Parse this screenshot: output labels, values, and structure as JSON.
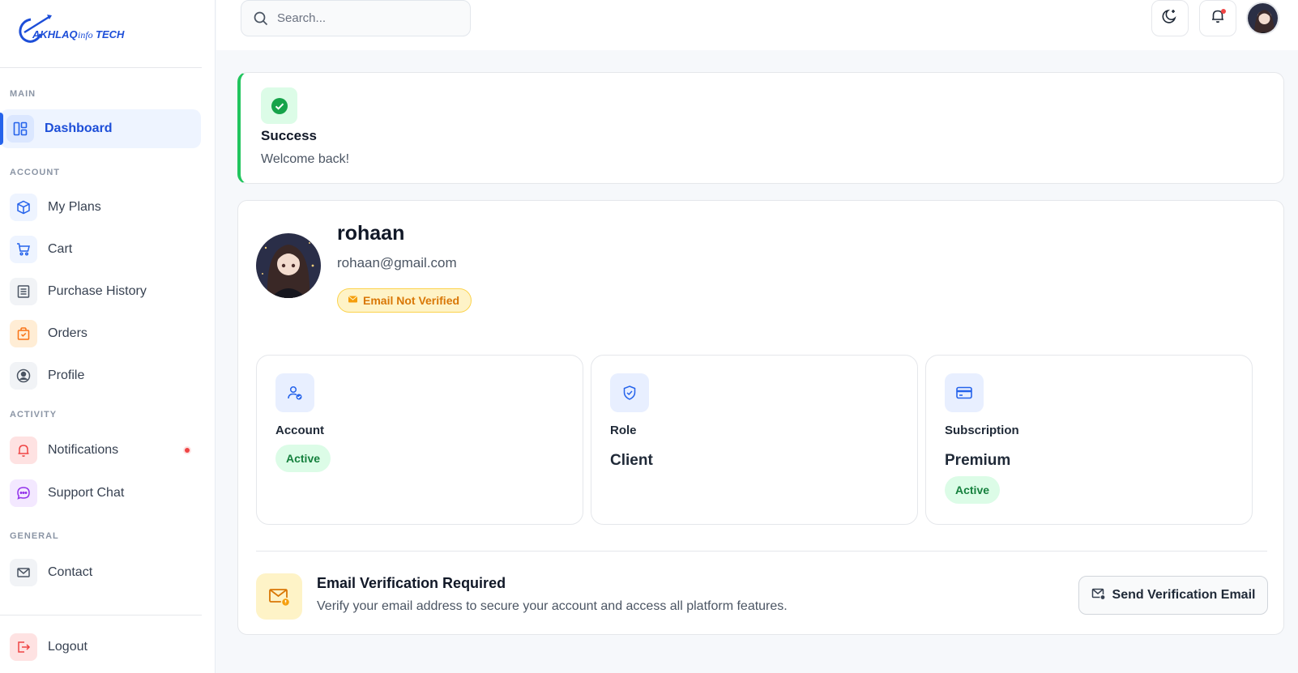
{
  "brand": {
    "logo_text": "AKHLAQ infoTECH"
  },
  "search": {
    "placeholder": "Search..."
  },
  "sidebar": {
    "sections": [
      {
        "label": "MAIN"
      },
      {
        "label": "ACCOUNT"
      },
      {
        "label": "ACTIVITY"
      },
      {
        "label": "GENERAL"
      }
    ],
    "items": [
      {
        "label": "Dashboard",
        "icon": "layout-icon",
        "color": "#2563eb",
        "active": true
      },
      {
        "label": "My Plans",
        "icon": "box-icon",
        "color": "#2563eb"
      },
      {
        "label": "Cart",
        "icon": "cart-icon",
        "color": "#2563eb"
      },
      {
        "label": "Purchase History",
        "icon": "receipt-icon",
        "color": "#6b7280"
      },
      {
        "label": "Orders",
        "icon": "bag-icon",
        "color": "#f97316"
      },
      {
        "label": "Profile",
        "icon": "user-circle-icon",
        "color": "#4b5563"
      },
      {
        "label": "Notifications",
        "icon": "bell-icon",
        "color": "#ef4444",
        "has_dot": true
      },
      {
        "label": "Support Chat",
        "icon": "chat-icon",
        "color": "#9333ea"
      },
      {
        "label": "Contact",
        "icon": "mail-icon",
        "color": "#4b5563"
      },
      {
        "label": "Logout",
        "icon": "logout-icon",
        "color": "#ef4444"
      }
    ]
  },
  "alert": {
    "title": "Success",
    "message": "Welcome back!",
    "color": "#22c55e"
  },
  "profile": {
    "username": "rohaan",
    "email": "rohaan@gmail.com",
    "verification_badge": "Email Not Verified"
  },
  "stats": [
    {
      "title": "Account",
      "status": "Active",
      "icon": "user-check-icon"
    },
    {
      "title": "Role",
      "value": "Client",
      "icon": "shield-check-icon"
    },
    {
      "title": "Subscription",
      "value": "Premium",
      "status": "Active",
      "icon": "credit-card-icon"
    }
  ],
  "verification": {
    "title": "Email Verification Required",
    "description": "Verify your email address to secure your account and access all platform features.",
    "button_label": "Send Verification Email"
  },
  "colors": {
    "accent": "#2563eb",
    "success": "#22c55e",
    "warning": "#d97706",
    "danger": "#ef4444"
  }
}
